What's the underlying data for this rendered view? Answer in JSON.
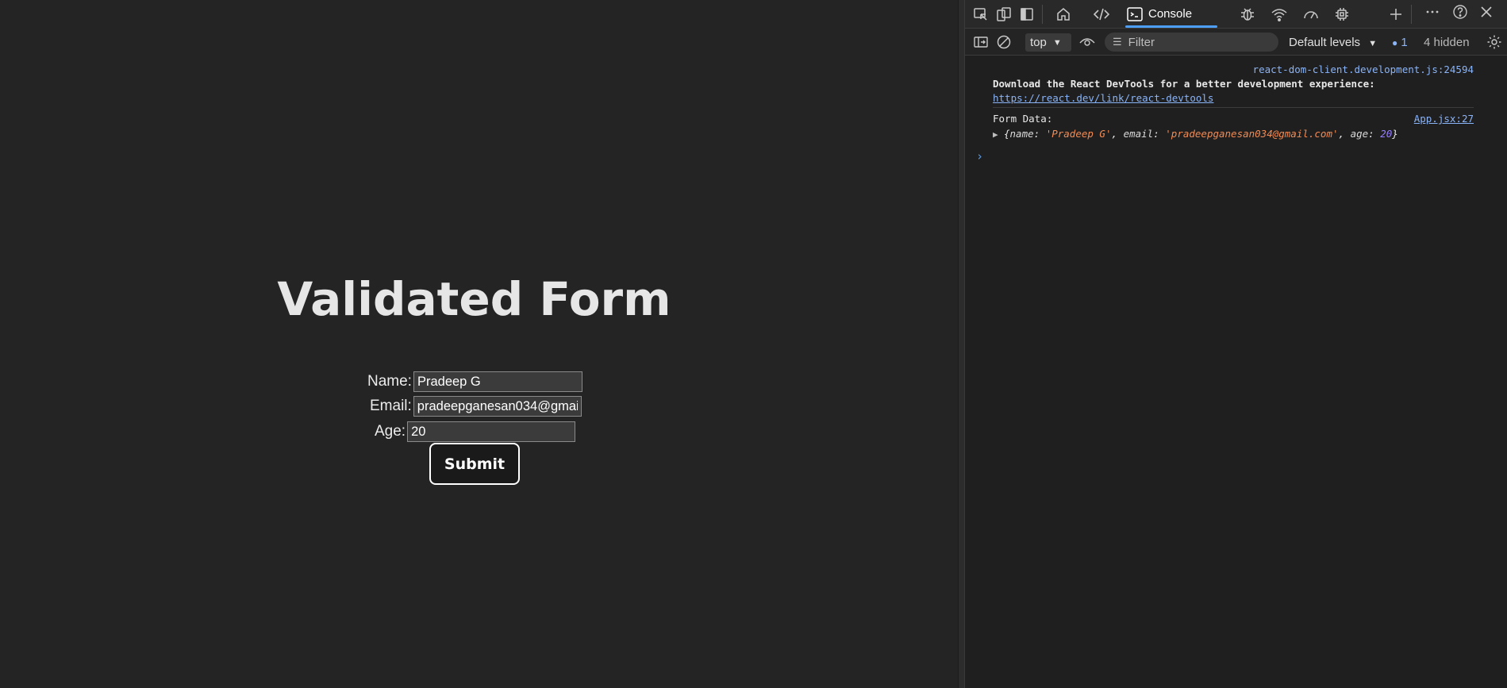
{
  "page": {
    "title": "Validated Form",
    "form": {
      "name_label": "Name:",
      "name_value": "Pradeep G",
      "email_label": "Email:",
      "email_value": "pradeepganesan034@gmail.com",
      "age_label": "Age:",
      "age_value": "20",
      "submit_label": "Submit"
    }
  },
  "devtools": {
    "toolbar": {
      "icons": [
        "inspect-icon",
        "device-toolbar-icon",
        "dock-sidebar-icon",
        "home-icon",
        "elements-icon",
        "console-icon",
        "sources-bug-icon",
        "network-wifi-icon",
        "performance-icon",
        "memory-chip-icon",
        "add-tab-icon",
        "more-icon",
        "help-icon",
        "close-icon"
      ],
      "active_tab": "Console"
    },
    "console_toolbar": {
      "context": "top",
      "filter_placeholder": "Filter",
      "levels": "Default levels",
      "issues_count": "1",
      "hidden": "4 hidden"
    },
    "messages": [
      {
        "source": "react-dom-client.development.js:24594",
        "text": "Download the React DevTools for a better development experience:",
        "link": "https://react.dev/link/react-devtools"
      },
      {
        "source": "App.jsx:27",
        "text": "Form Data:",
        "object": {
          "name_key": "name",
          "name_value": "'Pradeep G'",
          "email_key": "email",
          "email_value": "'pradeepganesan034@gmail.com'",
          "age_key": "age",
          "age_value": "20"
        }
      }
    ],
    "colors": {
      "accent": "#4d9ef6",
      "string": "#f28b54",
      "number": "#9980ff",
      "link": "#8ab4f8"
    }
  }
}
